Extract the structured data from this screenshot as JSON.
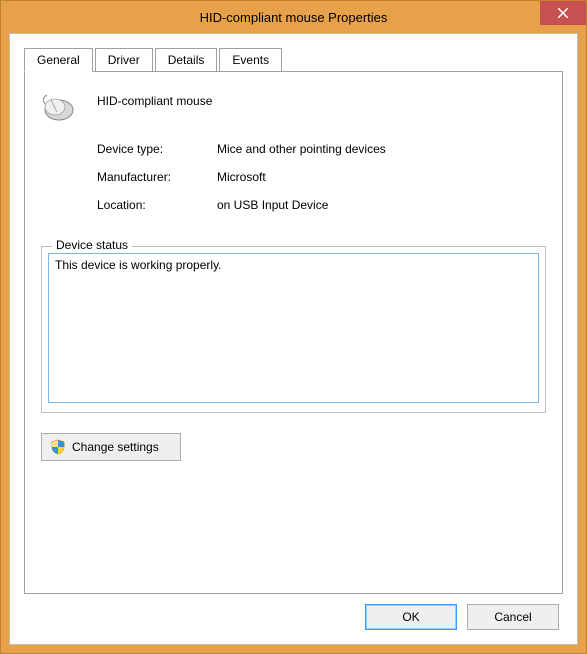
{
  "window": {
    "title": "HID-compliant mouse Properties"
  },
  "tabs": {
    "general": "General",
    "driver": "Driver",
    "details": "Details",
    "events": "Events"
  },
  "device": {
    "name": "HID-compliant mouse",
    "type_label": "Device type:",
    "type_value": "Mice and other pointing devices",
    "manufacturer_label": "Manufacturer:",
    "manufacturer_value": "Microsoft",
    "location_label": "Location:",
    "location_value": "on USB Input Device"
  },
  "status": {
    "legend": "Device status",
    "text": "This device is working properly."
  },
  "buttons": {
    "change_settings": "Change settings",
    "ok": "OK",
    "cancel": "Cancel"
  }
}
